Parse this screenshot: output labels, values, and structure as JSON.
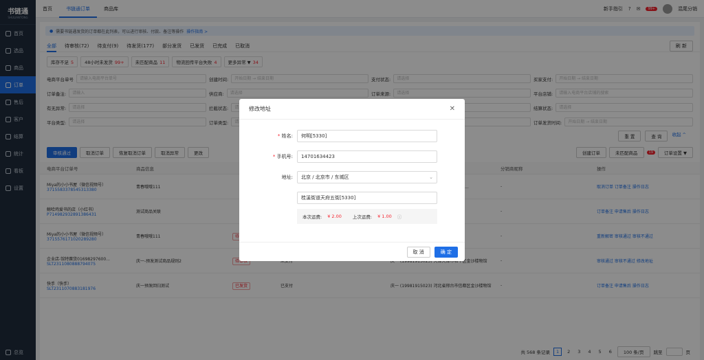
{
  "app": {
    "logo": "书链通",
    "logo_sub": "SHULIANTONG"
  },
  "sidebar": {
    "items": [
      {
        "label": "首页",
        "icon": "home-icon"
      },
      {
        "label": "选品",
        "icon": "select-icon"
      },
      {
        "label": "商品",
        "icon": "goods-icon"
      },
      {
        "label": "订单",
        "icon": "order-icon",
        "active": true
      },
      {
        "label": "售后",
        "icon": "aftersale-icon"
      },
      {
        "label": "客户",
        "icon": "customer-icon"
      },
      {
        "label": "结算",
        "icon": "settle-icon"
      },
      {
        "label": "统计",
        "icon": "stats-icon"
      },
      {
        "label": "看板",
        "icon": "board-icon"
      },
      {
        "label": "设置",
        "icon": "settings-icon"
      }
    ],
    "bottom": "总览"
  },
  "topbar": {
    "tabs": [
      "首页",
      "书链通订单",
      "商品库"
    ],
    "active": 1,
    "guide": "新手指引",
    "badge": "99+",
    "user": "混尾分销"
  },
  "notice": {
    "text": "需要书链通发货的订单都在此列表，可以进行审核、付款、备注等操作",
    "link": "操作指南 >"
  },
  "status_tabs": [
    "全部",
    "待审核(72)",
    "待支付(9)",
    "待发货(177)",
    "部分发货",
    "已发货",
    "已完成",
    "已取消"
  ],
  "refresh": "刷 新",
  "chips": [
    {
      "label": "库存不足",
      "count": "5"
    },
    {
      "label": "48小时未发货",
      "count": "99+"
    },
    {
      "label": "未匹配商品",
      "count": "11"
    },
    {
      "label": "物流回传平台失败",
      "count": "4"
    },
    {
      "label": "更多异常 ▼",
      "count": "34"
    }
  ],
  "filters": [
    [
      {
        "label": "电商平台单号",
        "ph": "请输入电商平台单号"
      },
      {
        "label": "创建时间:",
        "ph": "开始日期 → 结束日期"
      },
      {
        "label": "支付状态:",
        "ph": "请选择"
      },
      {
        "label": "买家支付:",
        "ph": "开始日期 → 结束日期"
      }
    ],
    [
      {
        "label": "订单备注:",
        "ph": "请输入"
      },
      {
        "label": "供应商:",
        "ph": "请选择"
      },
      {
        "label": "订单来源:",
        "ph": "请选择"
      },
      {
        "label": "平台店铺:",
        "ph": "请输入电商平台店铺的搜索"
      }
    ],
    [
      {
        "label": "有无异常:",
        "ph": "请选择"
      },
      {
        "label": "拦截状态:",
        "ph": "请选择"
      },
      {
        "label": "售后状态:",
        "ph": "请选择"
      },
      {
        "label": "结算状态:",
        "ph": "请选择"
      }
    ],
    [
      {
        "label": "平台类型:",
        "ph": "请选择"
      },
      {
        "label": "订单类型:",
        "ph": "请选择"
      },
      {
        "label": "物流公司:",
        "ph": "请选择"
      },
      {
        "label": "订单发货时间:",
        "ph": "开始日期 → 结束日期"
      }
    ]
  ],
  "filter_btns": {
    "reset": "重 置",
    "query": "查 询",
    "collapse": "收起 ^"
  },
  "toolbar": [
    "审核通过",
    "取消订单",
    "恢复取消订单",
    "取消异常",
    "更改"
  ],
  "toolbar_right": [
    "创建订单",
    "未匹配商品",
    "订单设置 ▼"
  ],
  "toolbar_badge": "19",
  "table": {
    "headers": [
      "电商平台订单号",
      "商品信息",
      "物流信息",
      "分销商昵称",
      "操作"
    ],
    "rows": [
      {
        "shop": "Miya的小小书屋（微信视频号）",
        "no": "3715583378545313380",
        "goods": "青春哦哦111",
        "status": "",
        "pay": "",
        "addr": "河南省三沙市中沙群岛区中和镇黄塘先锋...",
        "ops": "取消订单  订单备注  操作日志"
      },
      {
        "shop": "鲸哈鸡爱书的店（小红书）",
        "no": "P714982932891386431",
        "goods": "测试商品关联",
        "status": "",
        "pay": "",
        "addr": "极兔快递 JT3412321321",
        "ops": "订单备注  申请售后  操作日志"
      },
      {
        "shop": "Miya的小小书屋（微信视频号）",
        "no": "3715576171020289280",
        "goods": "青春哦哦111",
        "status": "待审核",
        "pay": "未支付",
        "addr": "河南省三沙市中沙群岛区中和镇黄塘先锋",
        "ops": "重新解密  审核通过  审核不通过"
      },
      {
        "shop": "企业店-馆特赛货01698297600...",
        "no": "SLT2311080888794075",
        "goods": "庆一-预发测试商品规则2",
        "status": "待审核",
        "pay": "未支付",
        "addr": "庆一 (19981915023) 天津天津市和平区金沙楼物馆",
        "ops": "审核通过  审核不通过  修改地址"
      },
      {
        "shop": "快手（快手）",
        "no": "SLT2311070883181976",
        "goods": "庆一预发回归测试",
        "status": "已发货",
        "pay": "已支付",
        "addr": "庆一 (19981915023) 河北省邢台市信都区金沙楼物馆",
        "ops": "订单备注  申请售后  操作日志"
      }
    ]
  },
  "pager": {
    "total": "共 568 条记录",
    "pages": [
      "1",
      "2",
      "3",
      "4",
      "5",
      "6"
    ],
    "size": "100 条/页",
    "jump": "跳至",
    "unit": "页"
  },
  "modal": {
    "title": "修改地址",
    "name_label": "姓名:",
    "name_val": "何明[5330]",
    "phone_label": "手机号:",
    "phone_val": "14701634423",
    "addr_label": "地址:",
    "region_val": "北京 / 北京市 / 东城区",
    "detail_val": "桂溪街道天府五街[5330]",
    "freight_label": "本次运费:",
    "freight_val": "¥ 2.00",
    "last_label": "上次运费:",
    "last_val": "¥ 1.00",
    "cancel": "取 消",
    "ok": "确 定"
  }
}
